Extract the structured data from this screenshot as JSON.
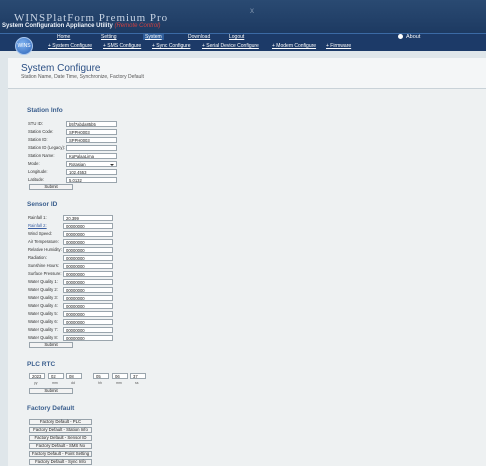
{
  "header": {
    "title": "WINSPlatForm Premium Pro",
    "subtitle": "System Configuration Appliance Utility",
    "subtitle_note": "(Remote Control)",
    "close": "x"
  },
  "logo": {
    "text": "WINS",
    "icon": "brand-logo"
  },
  "nav": {
    "items": [
      {
        "label": "Home"
      },
      {
        "label": "Setting"
      },
      {
        "label": "System"
      },
      {
        "label": "Download"
      },
      {
        "label": "Logout"
      }
    ],
    "about": "About",
    "sub": [
      {
        "label": "+ System Configure"
      },
      {
        "label": "+ SMS Configure"
      },
      {
        "label": "+ Sync Configure"
      },
      {
        "label": "+ Serial Device Configure"
      },
      {
        "label": "+ Modem Configure"
      },
      {
        "label": "+ Firmware"
      }
    ]
  },
  "page": {
    "title": "System Configure",
    "subtitle": "Station Name, Date Time, Synchronize, Factory Default"
  },
  "station_info": {
    "title": "Station Info",
    "fields": [
      {
        "label": "STU ID:",
        "value": "b5f7abda85b5"
      },
      {
        "label": "Station Code:",
        "value": "SPPH0003"
      },
      {
        "label": "Station ID:",
        "value": "SPPH0003"
      },
      {
        "label": "Station ID (Legacy):",
        "value": ""
      },
      {
        "label": "Station Name:",
        "value": "KgPalaaLima"
      },
      {
        "label": "Mode:",
        "value": "Rotasian"
      },
      {
        "label": "Longitude:",
        "value": "102.4553"
      },
      {
        "label": "Latitude:",
        "value": "5.0132"
      }
    ],
    "submit": "Submit"
  },
  "sensor_id": {
    "title": "Sensor ID",
    "fields": [
      {
        "label": "Rainfall 1:",
        "value": "20.399"
      },
      {
        "label": "Rainfall 2:",
        "value": "00000000"
      },
      {
        "label": "Wind Speed:",
        "value": "00000000"
      },
      {
        "label": "Air Temperature:",
        "value": "00000000"
      },
      {
        "label": "Relative Humidity:",
        "value": "00000000"
      },
      {
        "label": "Radiation:",
        "value": "00000000"
      },
      {
        "label": "Sunshine Hours:",
        "value": "00000000"
      },
      {
        "label": "Surface Pressure:",
        "value": "00000000"
      },
      {
        "label": "Water Quality 1:",
        "value": "00000000"
      },
      {
        "label": "Water Quality 2:",
        "value": "00000000"
      },
      {
        "label": "Water Quality 3:",
        "value": "00000000"
      },
      {
        "label": "Water Quality 4:",
        "value": "00000000"
      },
      {
        "label": "Water Quality 5:",
        "value": "00000000"
      },
      {
        "label": "Water Quality 6:",
        "value": "00000000"
      },
      {
        "label": "Water Quality 7:",
        "value": "00000000"
      },
      {
        "label": "Water Quality 8:",
        "value": "00000000"
      }
    ],
    "submit": "Submit"
  },
  "plc_rtc": {
    "title": "PLC RTC",
    "fields": [
      {
        "value": "2023",
        "unit": "yy"
      },
      {
        "value": "02",
        "unit": "mm"
      },
      {
        "value": "08",
        "unit": "dd"
      },
      {
        "value": "05",
        "unit": "hh"
      },
      {
        "value": "06",
        "unit": "mm"
      },
      {
        "value": "37",
        "unit": "ss"
      }
    ],
    "submit": "Submit"
  },
  "factory_default": {
    "title": "Factory Default",
    "buttons": [
      {
        "label": "Factory Default - PLC"
      },
      {
        "label": "Factory Default - Station Info"
      },
      {
        "label": "Factory Default - Sensor ID"
      },
      {
        "label": "Factory Default - SMS No"
      },
      {
        "label": "Factory Default - Point Setting"
      },
      {
        "label": "Factory Default - Sync Info"
      }
    ]
  }
}
